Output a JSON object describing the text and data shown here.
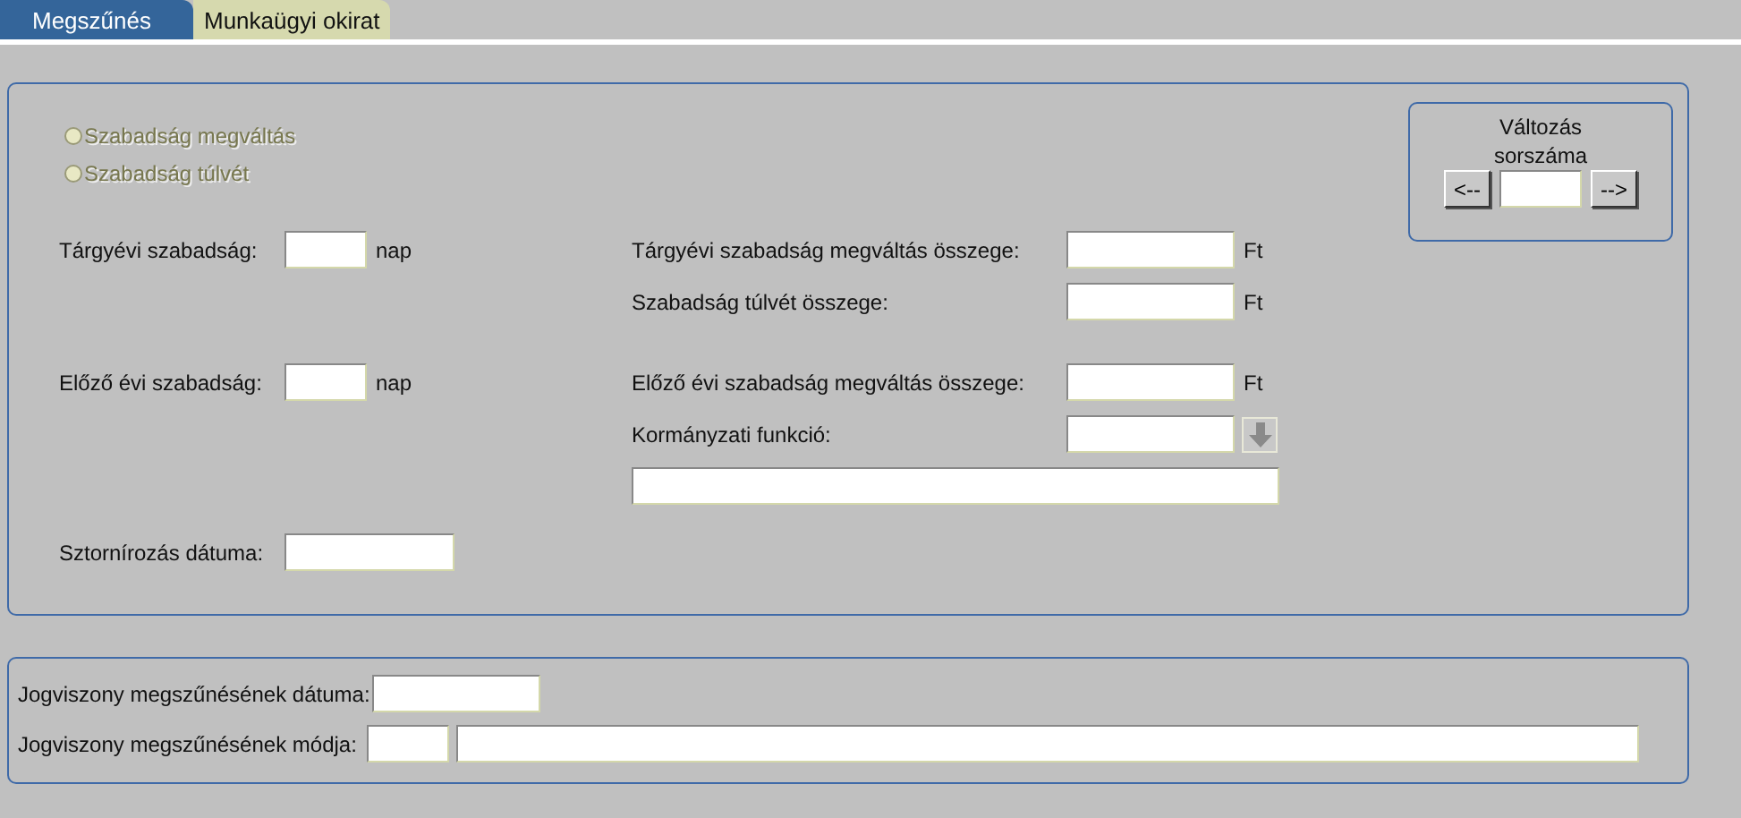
{
  "tabs": [
    {
      "label": "Megszűnés",
      "selected": true
    },
    {
      "label": "Munkaügyi okirat",
      "selected": false
    }
  ],
  "options": [
    {
      "label": "Szabadság megváltás",
      "selected": false,
      "disabled": true
    },
    {
      "label": "Szabadság túlvét",
      "selected": false,
      "disabled": true
    }
  ],
  "change_counter": {
    "title": "Változás sorszáma",
    "prev_button": "<--",
    "next_button": "-->"
  },
  "groups": [
    [
      {
        "left": {
          "label": "Tárgyévi szabadság:",
          "unit": "nap"
        },
        "right": {
          "kind": "amount",
          "label": "Tárgyévi szabadság megváltás összege:",
          "unit": "Ft"
        }
      },
      {
        "right": {
          "kind": "amount",
          "label": "Szabadság túlvét összege:",
          "unit": "Ft"
        }
      }
    ],
    [
      {
        "left": {
          "label": "Előző évi szabadság:",
          "unit": "nap"
        },
        "right": {
          "kind": "amount",
          "label": "Előző évi szabadság megváltás összege:",
          "unit": "Ft"
        }
      },
      {
        "right": {
          "kind": "lookup",
          "label": "Kormányzati funkció:"
        }
      },
      {
        "right": {
          "kind": "wide"
        }
      }
    ],
    [
      {
        "left": {
          "kind": "date",
          "label": "Sztornírozás dátuma:"
        }
      }
    ]
  ],
  "termination": [
    {
      "kind": "date",
      "label": "Jogviszony megszűnésének dátuma:"
    },
    {
      "kind": "code",
      "label": "Jogviszony megszűnésének módja:"
    }
  ]
}
